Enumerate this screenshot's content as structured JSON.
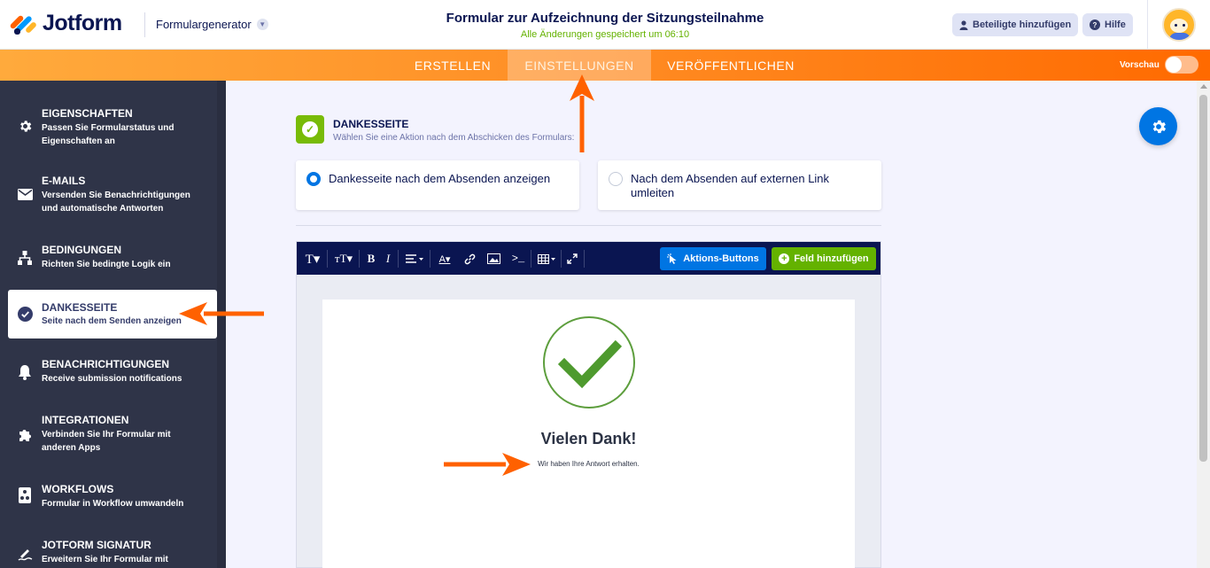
{
  "header": {
    "brand": "Jotform",
    "generator_label": "Formulargenerator",
    "form_title": "Formular zur Aufzeichnung der Sitzungsteilnahme",
    "save_status": "Alle Änderungen gespeichert um 06:10",
    "add_participants_label": "Beteiligte hinzufügen",
    "help_label": "Hilfe"
  },
  "nav": {
    "tabs": [
      {
        "label": "ERSTELLEN"
      },
      {
        "label": "EINSTELLUNGEN",
        "active": true
      },
      {
        "label": "VERÖFFENTLICHEN"
      }
    ],
    "preview_label": "Vorschau",
    "preview_on": false
  },
  "sidebar": {
    "items": [
      {
        "title": "EIGENSCHAFTEN",
        "desc": "Passen Sie Formularstatus und Eigenschaften an",
        "icon": "gear-icon"
      },
      {
        "title": "E-MAILS",
        "desc": "Versenden Sie Benachrichtigungen und automatische Antworten",
        "icon": "envelope-icon"
      },
      {
        "title": "BEDINGUNGEN",
        "desc": "Richten Sie bedingte Logik ein",
        "icon": "sitemap-icon"
      },
      {
        "title": "DANKESSEITE",
        "desc": "Seite nach dem Senden anzeigen",
        "icon": "check-circle-icon",
        "active": true
      },
      {
        "title": "BENACHRICHTIGUNGEN",
        "desc": "Receive submission notifications",
        "icon": "bell-icon"
      },
      {
        "title": "INTEGRATIONEN",
        "desc": "Verbinden Sie Ihr Formular mit anderen Apps",
        "icon": "puzzle-icon"
      },
      {
        "title": "WORKFLOWS",
        "desc": "Formular in Workflow umwandeln",
        "icon": "workflow-icon"
      },
      {
        "title": "JOTFORM SIGNATUR",
        "desc": "Erweitern Sie Ihr Formular mit Jotform",
        "icon": "signature-icon"
      }
    ]
  },
  "thankyou": {
    "title": "DANKESSEITE",
    "subtitle": "Wählen Sie eine Aktion nach dem Abschicken des Formulars:",
    "option_show": "Dankesseite nach dem Absenden anzeigen",
    "option_redirect": "Nach dem Absenden auf externen Link umleiten",
    "selected": "option_show"
  },
  "editor": {
    "actions_button": "Aktions-Buttons",
    "add_field_button": "Feld hinzufügen",
    "heading": "Vielen Dank!",
    "message": "Wir haben Ihre Antwort erhalten."
  },
  "colors": {
    "brand_navy": "#0a1551",
    "accent_orange": "#ff6100",
    "primary_blue": "#0075e3",
    "success_green": "#64b200",
    "sidebar_bg": "#2f3448",
    "annotation_arrow": "#ff6100"
  }
}
